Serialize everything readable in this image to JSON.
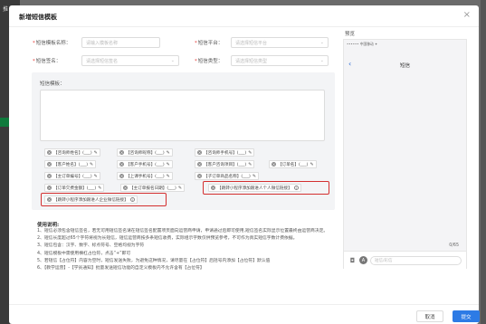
{
  "background": {
    "text": "推",
    "accent": "#0f7a3c"
  },
  "modal": {
    "title": "新增短信模板",
    "close_icon": "close-icon"
  },
  "form": {
    "template_name": {
      "label": "短信模板名称：",
      "placeholder": "请输入模板名称"
    },
    "platform": {
      "label": "短信平台：",
      "placeholder": "请选择短信平台"
    },
    "signature": {
      "label": "短信签名：",
      "placeholder": "请选择短信签名"
    },
    "type": {
      "label": "短信类型：",
      "placeholder": "请选择短信类型"
    },
    "content_label": "短信模板："
  },
  "tags": [
    "【咨询师姓名】(___)",
    "【咨询师昵称】(___)",
    "【咨询师手机号】(___)",
    "【客户姓名】(___)",
    "【客户手机号】(___)",
    "【客户咨询项目】(___)",
    "【订单名】(___)",
    "【主订单编号】(___)",
    "【上课手机号】(___)",
    "【子订单商品名称】(___)",
    "【订单欠费金额】(___)",
    "【主订单报名日期】(___)",
    "【跳转小程序添加跟进人个人微信链接】",
    "【跳转小程序添加跟进人企业微信链接】"
  ],
  "usage": {
    "title": "使用说明:",
    "lines": [
      "1、短信必须包含短信签名，若无可用短信签名请在短信签名配置项页面向运营商申请，申请通过后即可使用,短信签名实际显示位置最终由运营商决定。",
      "2、短信长度超过65个字符将视为长短信，短信运营商按多条短信收费，实际组示字数仅供预览参考，不可作为真实短信字数计费依据。",
      "3、短信包含：汉字、数字、标点符号、空格均视为字符",
      "4、短信模板中需使用横杠占位符，点击“+”即可",
      "5、若短信【占位符】内容为空时，短信发送失败，为避免这种情况，请尽量在【占位符】后括号内添加【占位符】默认值",
      "6、【教学运营】-【学员通知】批量发送短信功能的自定义模板内不允许含有【占位符】"
    ]
  },
  "preview": {
    "label": "预览",
    "status_text": "•••••• 中国移动 ✦",
    "title": "短信",
    "counter": "0/65",
    "input_placeholder": "短信/彩信",
    "back_icon": "chevron-left-icon",
    "camera_icon": "camera-icon",
    "apps_icon": "app-store-icon"
  },
  "buttons": {
    "cancel": "取消",
    "submit": "提交"
  },
  "colors": {
    "primary": "#2d7be5",
    "highlight": "#d32f2f",
    "required": "#e53935"
  }
}
